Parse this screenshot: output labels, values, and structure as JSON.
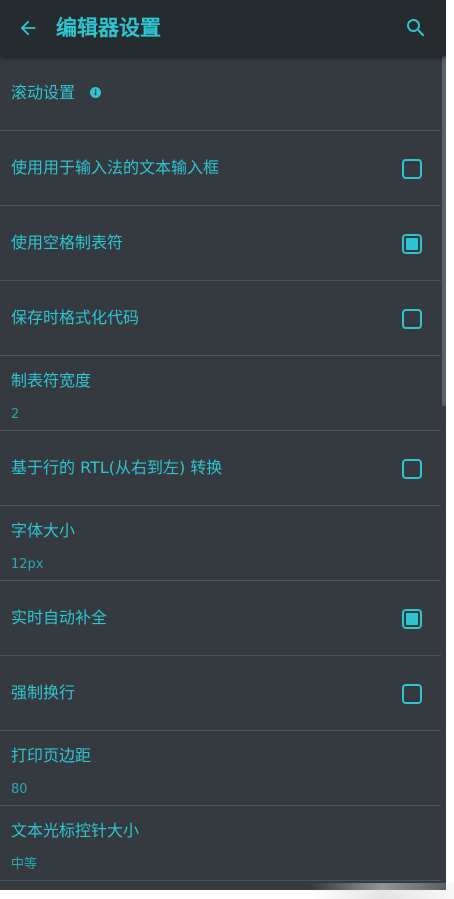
{
  "appbar": {
    "title": "编辑器设置",
    "back_icon": "arrow-left-icon",
    "search_icon": "search-icon"
  },
  "colors": {
    "accent": "#2ec4d0",
    "background": "#343a40",
    "appbar": "#262b30",
    "divider": "#4c5359"
  },
  "settings": [
    {
      "id": "scroll-settings",
      "type": "category",
      "title": "滚动设置",
      "icon": "info-icon"
    },
    {
      "id": "ime-input-box",
      "type": "checkbox",
      "title": "使用用于输入法的文本输入框",
      "checked": false
    },
    {
      "id": "space-tab",
      "type": "checkbox",
      "title": "使用空格制表符",
      "checked": true
    },
    {
      "id": "format-on-save",
      "type": "checkbox",
      "title": "保存时格式化代码",
      "checked": false
    },
    {
      "id": "tab-width",
      "type": "value",
      "title": "制表符宽度",
      "summary": "2"
    },
    {
      "id": "rtl-line",
      "type": "checkbox",
      "title": "基于行的 RTL(从右到左) 转换",
      "checked": false
    },
    {
      "id": "font-size",
      "type": "value",
      "title": "字体大小",
      "summary": "12px"
    },
    {
      "id": "live-autocomplete",
      "type": "checkbox",
      "title": "实时自动补全",
      "checked": true
    },
    {
      "id": "force-wrap",
      "type": "checkbox",
      "title": "强制换行",
      "checked": false
    },
    {
      "id": "print-margin",
      "type": "value",
      "title": "打印页边距",
      "summary": "80"
    },
    {
      "id": "cursor-handle-size",
      "type": "value",
      "title": "文本光标控针大小",
      "summary": "中等"
    }
  ]
}
